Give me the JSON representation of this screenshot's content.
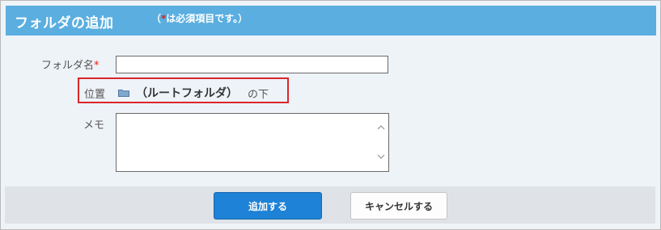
{
  "header": {
    "title": "フォルダの追加",
    "note_prefix": "（",
    "note_required_mark": "*",
    "note_suffix": "は必須項目です。）"
  },
  "form": {
    "folder_name": {
      "label": "フォルダ名",
      "required_mark": "*",
      "value": ""
    },
    "location": {
      "label": "位置",
      "icon": "folder-icon",
      "folder": "（ルートフォルダ）",
      "suffix": "の下"
    },
    "memo": {
      "label": "メモ",
      "value": ""
    }
  },
  "buttons": {
    "add": "追加する",
    "cancel": "キャンセルする"
  },
  "colors": {
    "header_bg": "#5aaee0",
    "primary_button": "#1e82d6",
    "required": "#e0211b",
    "highlight_border": "#d9262a"
  }
}
